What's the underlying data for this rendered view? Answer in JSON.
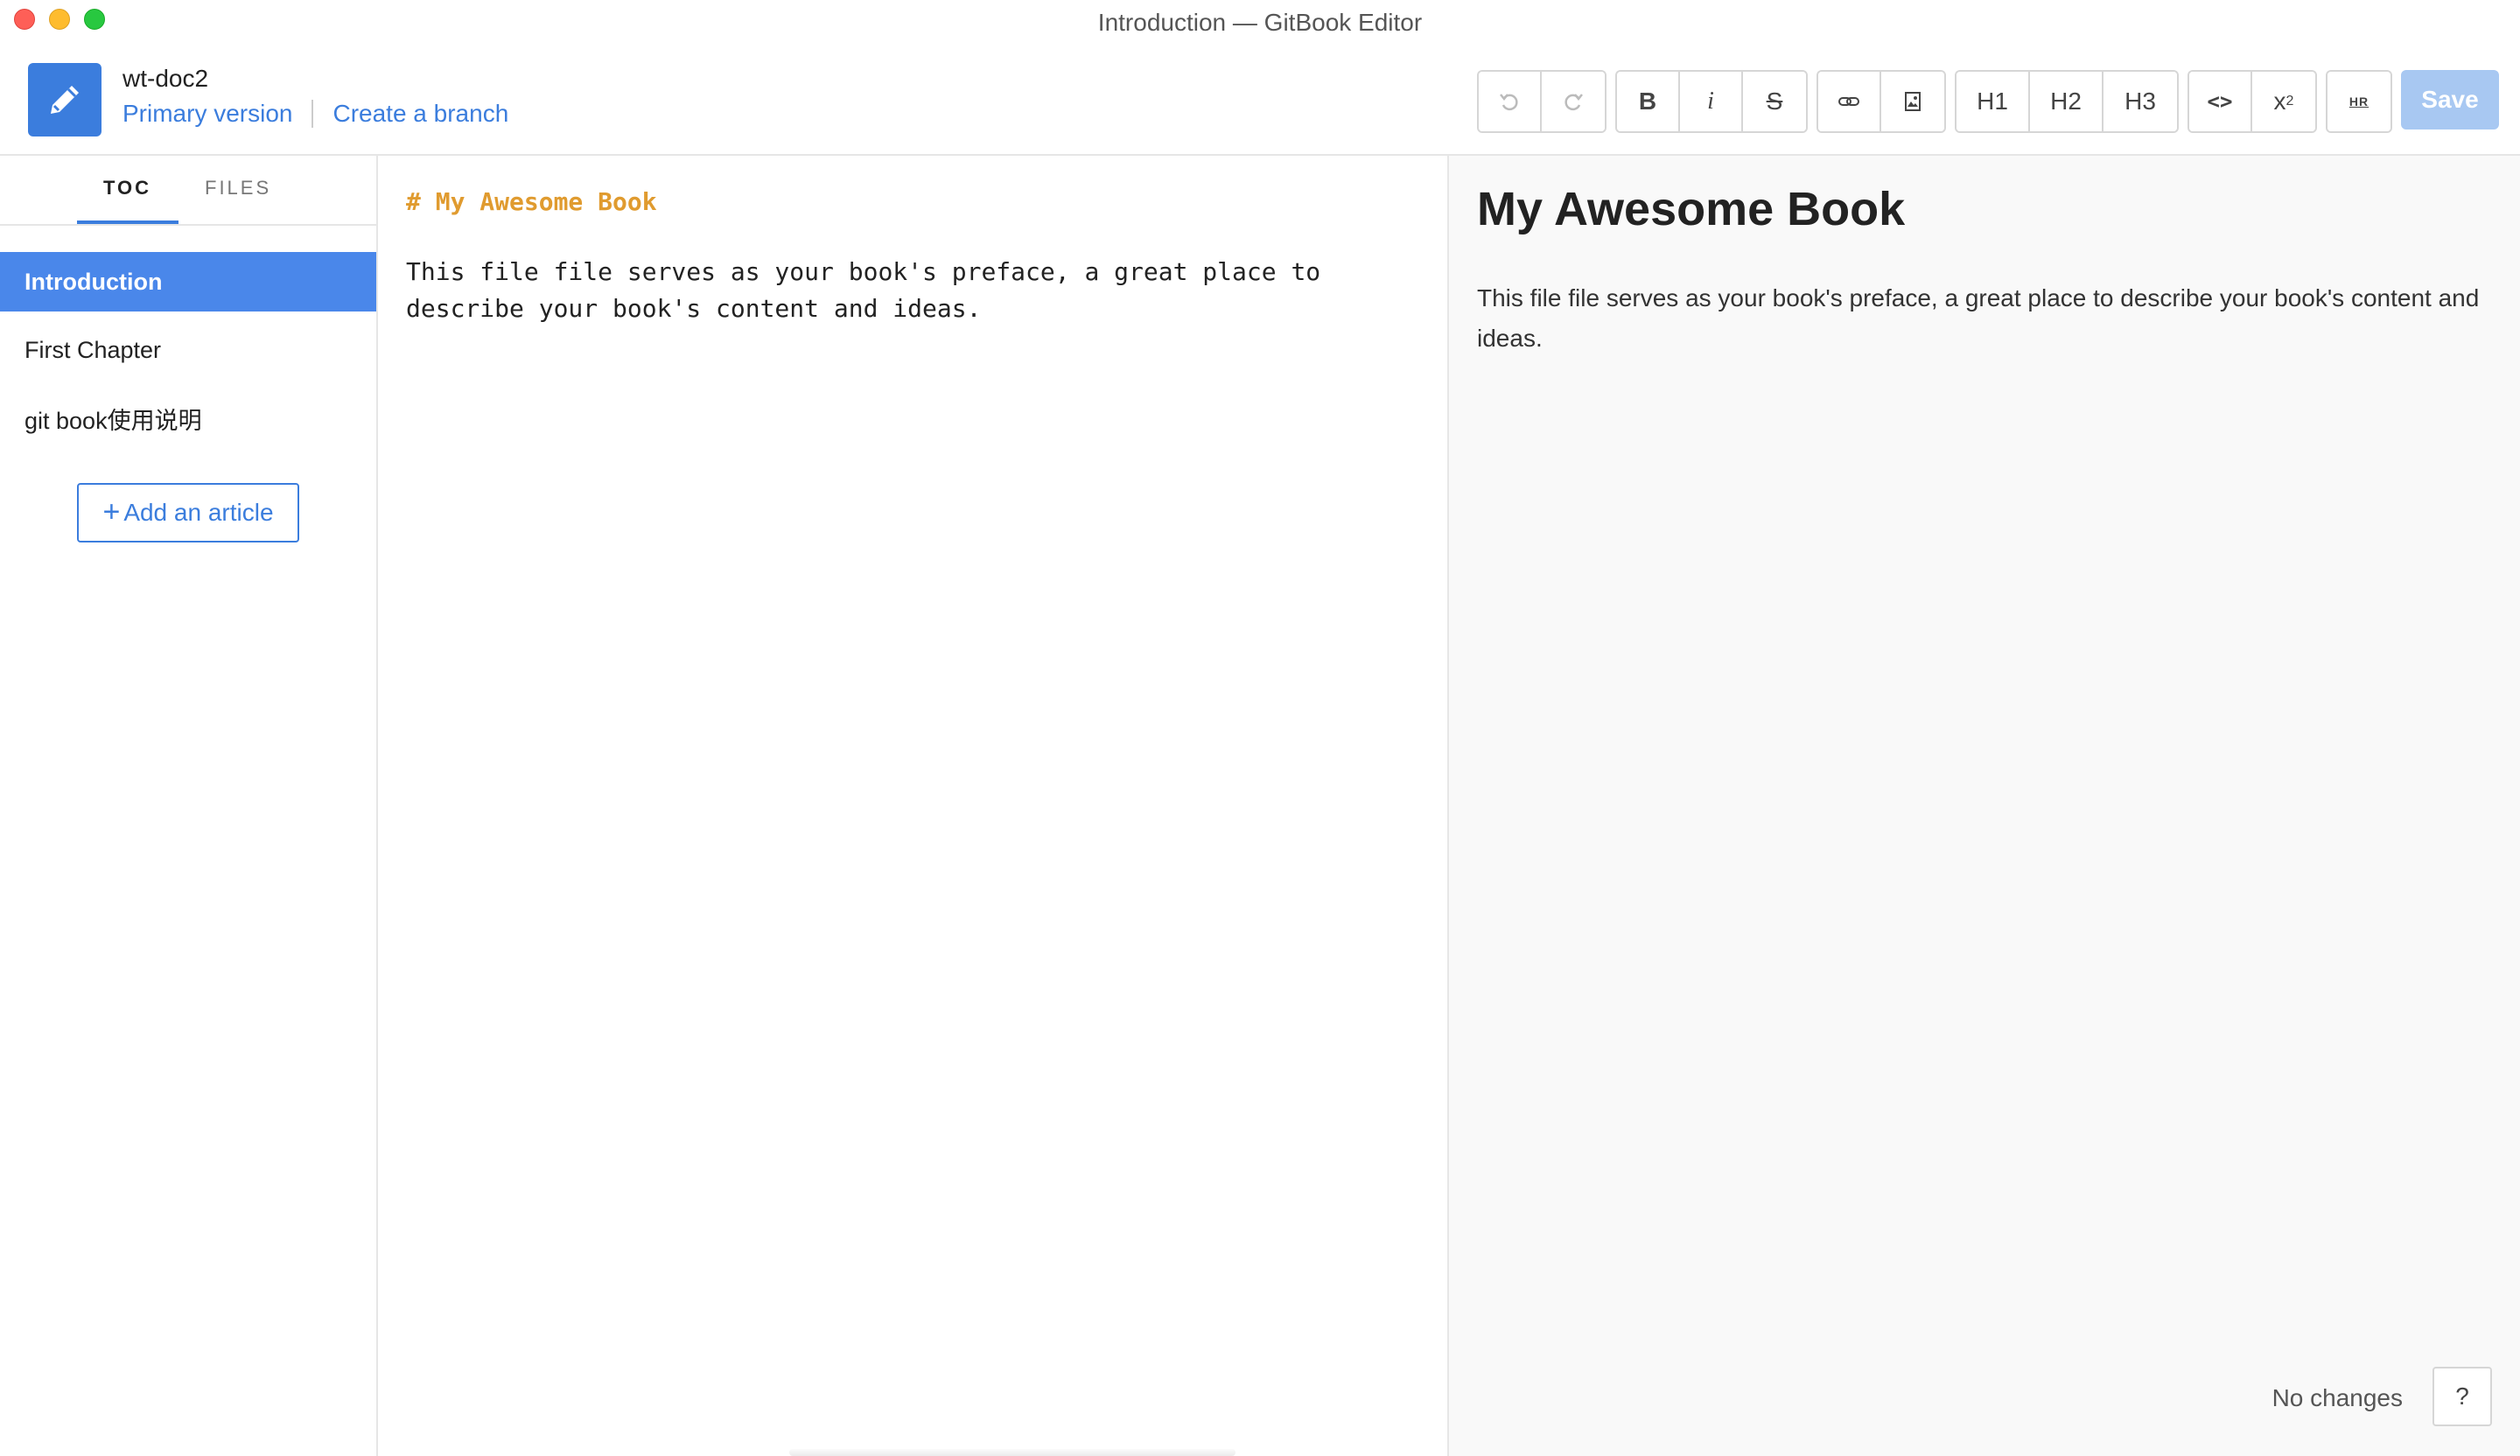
{
  "window": {
    "title": "Introduction — GitBook Editor"
  },
  "header": {
    "book_name": "wt-doc2",
    "primary_version": "Primary version",
    "create_branch": "Create a branch"
  },
  "toolbar": {
    "undo_icon": "undo-icon",
    "redo_icon": "redo-icon",
    "bold": "B",
    "italic": "i",
    "strike": "S",
    "link_icon": "link-icon",
    "image_icon": "image-icon",
    "h1": "H1",
    "h2": "H2",
    "h3": "H3",
    "code": "<>",
    "subscript_base": "x",
    "subscript_sub": "2",
    "hr": "HR",
    "save": "Save"
  },
  "sidebar": {
    "tabs": [
      "TOC",
      "FILES"
    ],
    "items": [
      {
        "label": "Introduction",
        "active": true
      },
      {
        "label": "First Chapter",
        "active": false
      },
      {
        "label": "git book使用说明",
        "active": false
      }
    ],
    "add_article": "Add an article"
  },
  "editor": {
    "heading_line": "# My Awesome Book",
    "paragraph": "This file file serves as your book's preface, a great place to\ndescribe your book's content and ideas."
  },
  "preview": {
    "title": "My Awesome Book",
    "text": "This file file serves as your book's preface, a great place to describe your book's content and ideas."
  },
  "status": {
    "text": "No changes",
    "help": "?"
  },
  "colors": {
    "accent": "#3b7ddd",
    "active_item": "#4a87ea",
    "markdown_heading": "#e09b2f",
    "save_disabled": "#a8c8f2"
  }
}
